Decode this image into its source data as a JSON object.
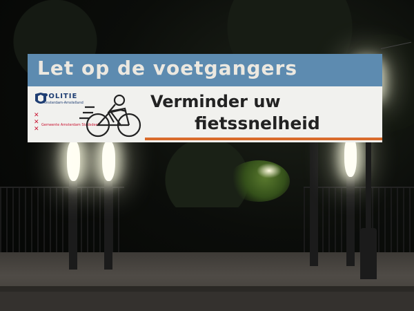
{
  "banner": {
    "headline": "Let op de voetgangers",
    "line1": "Verminder uw",
    "line2": "fietssnelheid",
    "police_word": "POLITIE",
    "police_sub": "Amsterdam-Amstelland",
    "ams_text": "Gemeente Amsterdam Stadsdeel"
  },
  "colors": {
    "banner_top": "#5d8bb0",
    "banner_body": "#f1f1ee",
    "accent_stripe": "#d96b2b",
    "text_dark": "#222222"
  },
  "icons": [
    "police-logo-icon",
    "amsterdam-xxx-icon",
    "cyclist-illustration-icon",
    "street-lamp-icon"
  ]
}
